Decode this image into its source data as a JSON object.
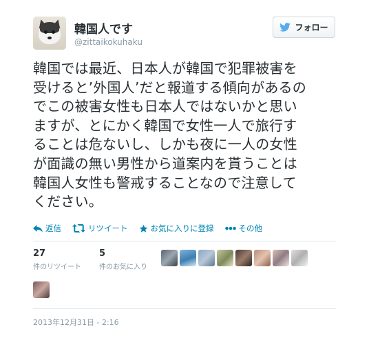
{
  "user": {
    "display_name": "韓国人です",
    "screen_name": "@zittaikokuhaku",
    "avatar_icon": "husky-dog-avatar"
  },
  "follow_button": {
    "label": "フォロー",
    "icon": "twitter-bird-icon",
    "color": "#55acee"
  },
  "tweet": {
    "lines": [
      "韓国では最近、日本人が韓国で犯罪被害を",
      "受けると’外国人’だと報道する傾向があるの",
      "でこの被害女性も日本人ではないかと思い",
      "ますが、とにかく韓国で女性一人で旅行す",
      "ることは危ないし、しかも夜に一人の女性",
      "が面識の無い男性から道案内を貰うことは",
      "韓国人女性も警戒することなので注意して",
      "ください。"
    ]
  },
  "actions": [
    {
      "label": "返信",
      "icon": "reply-icon"
    },
    {
      "label": "リツイート",
      "icon": "retweet-icon"
    },
    {
      "label": "お気に入りに登録",
      "icon": "star-icon"
    },
    {
      "label": "その他",
      "icon": "more-dots-icon"
    }
  ],
  "stats": {
    "retweets": {
      "count": "27",
      "label": "件のリツイート"
    },
    "favorites": {
      "count": "5",
      "label": "件のお気に入り"
    }
  },
  "timestamp": "2013年12月31日 - 2:16",
  "colors": {
    "link": "#0084b4",
    "text": "#292f33",
    "muted": "#8899a6",
    "border": "#e1e8ed"
  }
}
